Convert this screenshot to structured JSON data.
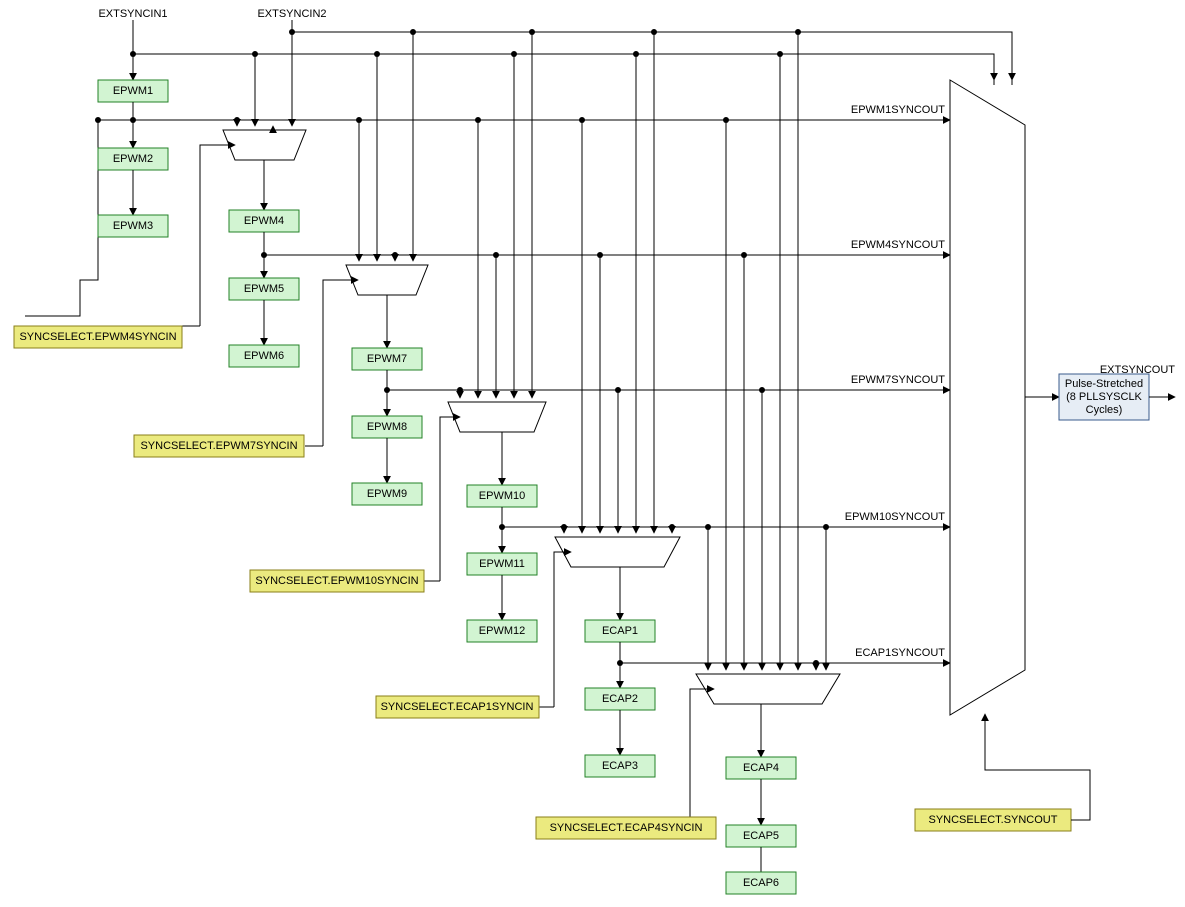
{
  "labels": {
    "extsyncin1": "EXTSYNCIN1",
    "extsyncin2": "EXTSYNCIN2",
    "extsyncoutLbl": "EXTSYNCOUT"
  },
  "blocks": {
    "epwm1": "EPWM1",
    "epwm2": "EPWM2",
    "epwm3": "EPWM3",
    "epwm4": "EPWM4",
    "epwm5": "EPWM5",
    "epwm6": "EPWM6",
    "epwm7": "EPWM7",
    "epwm8": "EPWM8",
    "epwm9": "EPWM9",
    "epwm10": "EPWM10",
    "epwm11": "EPWM11",
    "epwm12": "EPWM12",
    "ecap1": "ECAP1",
    "ecap2": "ECAP2",
    "ecap3": "ECAP3",
    "ecap4": "ECAP4",
    "ecap5": "ECAP5",
    "ecap6": "ECAP6"
  },
  "yellow": {
    "sel4": "SYNCSELECT.EPWM4SYNCIN",
    "sel7": "SYNCSELECT.EPWM7SYNCIN",
    "sel10": "SYNCSELECT.EPWM10SYNCIN",
    "selEcap1": "SYNCSELECT.ECAP1SYNCIN",
    "selEcap4": "SYNCSELECT.ECAP4SYNCIN",
    "selSyncout": "SYNCSELECT.SYNCOUT"
  },
  "syncout": {
    "epwm1": "EPWM1SYNCOUT",
    "epwm4": "EPWM4SYNCOUT",
    "epwm7": "EPWM7SYNCOUT",
    "epwm10": "EPWM10SYNCOUT",
    "ecap1": "ECAP1SYNCOUT"
  },
  "pulse": {
    "l1": "Pulse-Stretched",
    "l2": "(8 PLLSYSCLK",
    "l3": "Cycles)"
  }
}
